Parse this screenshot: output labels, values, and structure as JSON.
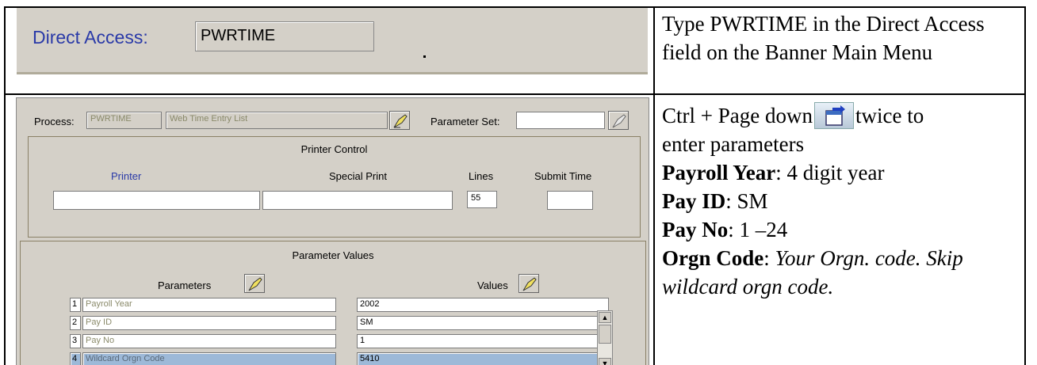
{
  "row1": {
    "direct_access_label": "Direct Access:",
    "direct_access_value": "PWRTIME",
    "instruction": "Type PWRTIME in the Direct Access field on the Banner Main Menu"
  },
  "row2": {
    "process_label": "Process:",
    "process_code": "PWRTIME",
    "process_desc": "Web Time Entry List",
    "parameter_set_label": "Parameter Set:",
    "parameter_set_value": "",
    "printer_control_title": "Printer Control",
    "printer_label": "Printer",
    "special_print_label": "Special Print",
    "lines_label": "Lines",
    "lines_value": "55",
    "submit_time_label": "Submit Time",
    "parameter_values_title": "Parameter Values",
    "parameters_header": "Parameters",
    "values_header": "Values",
    "params": [
      {
        "num": "1",
        "name": "Payroll Year",
        "value": "2002"
      },
      {
        "num": "2",
        "name": "Pay ID",
        "value": "SM"
      },
      {
        "num": "3",
        "name": "Pay No",
        "value": "1"
      },
      {
        "num": "4",
        "name": "Wildcard Orgn Code",
        "value": "5410"
      }
    ],
    "instr_line1_a": "Ctrl + Page down",
    "instr_line1_b": "twice to",
    "instr_line2": "enter parameters",
    "items": [
      {
        "label": "Payroll Year",
        "text": ": 4 digit year"
      },
      {
        "label": "Pay ID",
        "text": ": SM"
      },
      {
        "label": "Pay No",
        "text": ": 1 –24"
      }
    ],
    "orgn_label": "Orgn Code",
    "orgn_text": "Your Orgn. code. Skip wildcard orgn code."
  }
}
